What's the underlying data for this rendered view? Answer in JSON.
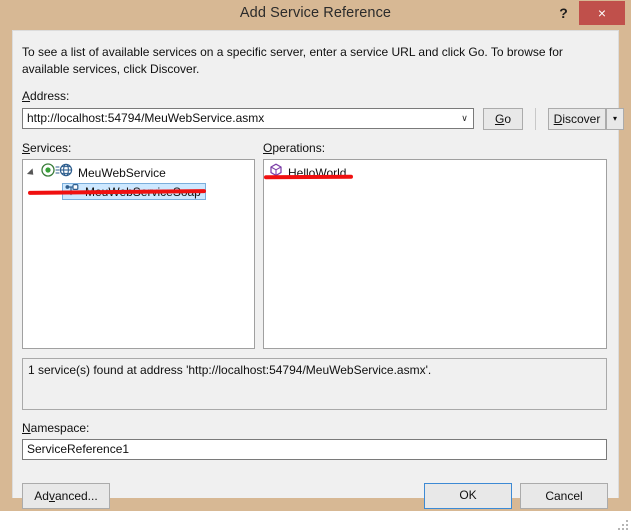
{
  "window": {
    "title": "Add Service Reference",
    "help_label": "?",
    "close_label": "×"
  },
  "main": {
    "intro_text": "To see a list of available services on a specific server, enter a service URL and click Go. To browse for available services, click Discover.",
    "address": {
      "label_pre": "A",
      "label_post": "ddress:",
      "value": "http://localhost:54794/MeuWebService.asmx",
      "placeholder": "",
      "dropdown_icon": "chevron-down-icon",
      "dropdown_glyph": "∨"
    },
    "go_button": {
      "label_pre": "G",
      "label_post": "o"
    },
    "discover_button": {
      "label_pre": "D",
      "label_post": "iscover",
      "split_glyph": "▾"
    },
    "services": {
      "label_pre": "S",
      "label_post": "ervices:",
      "tree": [
        {
          "label": "MeuWebService",
          "icon": "web-service-icon",
          "expanded": true,
          "selected": false
        },
        {
          "label": "MeuWebServiceSoap",
          "icon": "service-endpoint-icon",
          "expanded": false,
          "selected": true
        }
      ]
    },
    "operations": {
      "label_pre": "O",
      "label_post": "perations:",
      "items": [
        {
          "label": "HelloWorld",
          "icon": "method-cube-icon",
          "selected": false
        }
      ]
    },
    "status": {
      "text": "1 service(s) found at address 'http://localhost:54794/MeuWebService.asmx'."
    },
    "namespace": {
      "label_pre": "N",
      "label_post": "amespace:",
      "value": "ServiceReference1"
    }
  },
  "footer": {
    "advanced_pre": "Ad",
    "advanced_mid": "v",
    "advanced_post": "anced...",
    "ok_label": "OK",
    "cancel_label": "Cancel"
  },
  "colors": {
    "chrome": "#d7b894",
    "close_button": "#c0504b",
    "dialog_body": "#f0f0f0",
    "selection": "#cde8ff",
    "annotation": "#f01010",
    "focus_border": "#3d8ad4"
  }
}
